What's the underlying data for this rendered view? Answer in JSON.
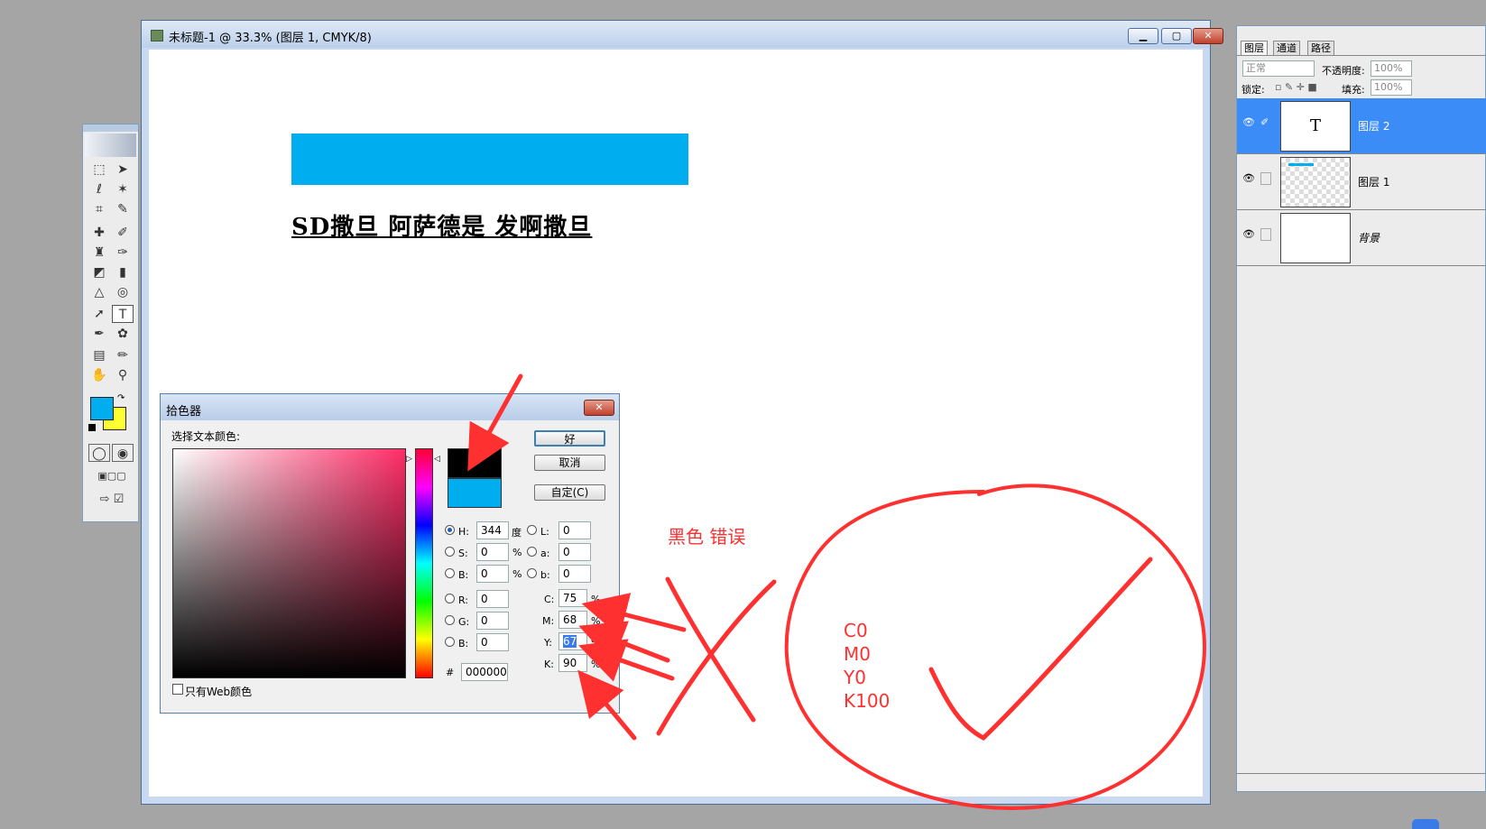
{
  "document": {
    "title": "未标题-1 @ 33.3% (图层 1, CMYK/8)",
    "canvas_text": "SD撒旦 阿萨德是 发啊撒旦",
    "window_buttons": [
      "▁",
      "▢",
      "✕"
    ]
  },
  "colors": {
    "fill_blue": "#00aeef",
    "annotation_red": "#ff3030",
    "selected_layer": "#3b8cf6",
    "background_swatch": "#ffff33"
  },
  "layers_panel": {
    "tabs": [
      "图层",
      "通道",
      "路径"
    ],
    "blend_mode": "正常",
    "opacity_label": "不透明度:",
    "opacity_value": "100%",
    "lock_label": "锁定:",
    "fill_label": "填充:",
    "fill_value": "100%",
    "layers": [
      {
        "name": "图层 2",
        "thumb_text": "T",
        "selected": true
      },
      {
        "name": "图层 1",
        "thumb_text": "",
        "selected": false
      },
      {
        "name": "背景",
        "thumb_text": "",
        "selected": false
      }
    ]
  },
  "picker": {
    "title": "拾色器",
    "prompt": "选择文本颜色:",
    "ok": "好",
    "cancel": "取消",
    "custom": "自定(C)",
    "web_only": "只有Web颜色",
    "hsb": {
      "H": "344",
      "S": "0",
      "B": "0"
    },
    "hsb_units": {
      "H": "度",
      "S": "%",
      "B": "%"
    },
    "lab": {
      "L": "0",
      "a": "0",
      "b": "0"
    },
    "rgb": {
      "R": "0",
      "G": "0",
      "B": "0"
    },
    "cmyk": {
      "C": "75",
      "M": "68",
      "Y": "67",
      "K": "90"
    },
    "percent": "%",
    "hex_label": "#",
    "hex": "000000"
  },
  "annotations": {
    "wrong_label": "黑色 错误",
    "correct_values": [
      "C0",
      "M0",
      "Y0",
      "K100"
    ]
  },
  "toolbox": {
    "tool_icons": [
      "marquee-icon",
      "move-icon",
      "lasso-icon",
      "magic-wand-icon",
      "crop-icon",
      "slice-icon",
      "healing-brush-icon",
      "brush-icon",
      "clone-stamp-icon",
      "history-brush-icon",
      "eraser-icon",
      "gradient-icon",
      "blur-icon",
      "dodge-icon",
      "path-select-icon",
      "type-icon",
      "pen-icon",
      "shape-icon",
      "notes-icon",
      "eyedropper-icon",
      "hand-icon",
      "zoom-icon"
    ]
  }
}
